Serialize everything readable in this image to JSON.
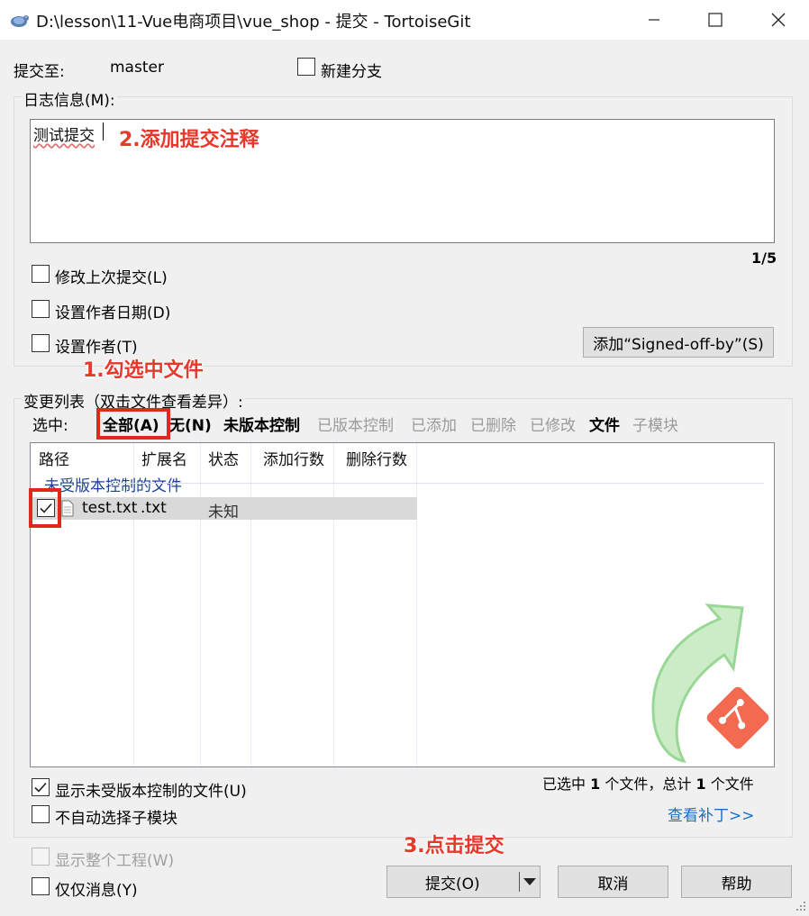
{
  "window": {
    "title": "D:\\lesson\\11-Vue电商项目\\vue_shop - 提交 - TortoiseGit",
    "app_icon": "tortoise-icon"
  },
  "commit_to": {
    "label": "提交至:",
    "branch": "master",
    "new_branch_label": "新建分支",
    "new_branch_checked": false
  },
  "log": {
    "group_label": "日志信息(M):",
    "message": "测试提交",
    "counter": "1/5",
    "amend_label": "修改上次提交(L)",
    "amend_checked": false,
    "set_date_label": "设置作者日期(D)",
    "set_date_checked": false,
    "set_author_label": "设置作者(T)",
    "set_author_checked": false,
    "signed_off_button": "添加“Signed-off-by”(S)"
  },
  "changes": {
    "group_label": "变更列表（双击文件查看差异）:",
    "select_label": "选中:",
    "filters": [
      {
        "label": "全部(A)",
        "style": "bold"
      },
      {
        "label": "无(N)",
        "style": "bold"
      },
      {
        "label": "未版本控制",
        "style": "bold"
      },
      {
        "label": "已版本控制",
        "style": "gray"
      },
      {
        "label": "已添加",
        "style": "gray"
      },
      {
        "label": "已删除",
        "style": "gray"
      },
      {
        "label": "已修改",
        "style": "gray"
      },
      {
        "label": "文件",
        "style": "bold"
      },
      {
        "label": "子模块",
        "style": "gray"
      }
    ],
    "columns": [
      "路径",
      "扩展名",
      "状态",
      "添加行数",
      "删除行数"
    ],
    "group_header": "未受版本控制的文件",
    "rows": [
      {
        "checked": true,
        "path": "test.txt",
        "ext": ".txt",
        "status": "未知",
        "added": "",
        "deleted": "",
        "icon": "text-file-icon"
      }
    ],
    "summary": {
      "pre": "已选中",
      "selected": "1",
      "mid": "个文件，总计",
      "total": "1",
      "post": "个文件"
    },
    "show_unversioned_label": "显示未受版本控制的文件(U)",
    "show_unversioned_checked": true,
    "no_auto_submodule_label": "不自动选择子模块",
    "no_auto_submodule_checked": false,
    "view_patch_link": "查看补丁>>"
  },
  "bottom": {
    "show_whole_project_label": "显示整个工程(W)",
    "show_whole_project_checked": false,
    "show_whole_project_disabled": true,
    "message_only_label": "仅仅消息(Y)",
    "message_only_checked": false,
    "commit_button": "提交(O)",
    "cancel_button": "取消",
    "help_button": "帮助"
  },
  "annotations": {
    "step1": "1.勾选中文件",
    "step2": "2.添加提交注释",
    "step3": "3.点击提交"
  },
  "colors": {
    "annotation_red": "#e8372b",
    "link_blue": "#1a6fc1",
    "group_header_blue": "#1c3f9a",
    "git_logo_red": "#f05133",
    "watermark_green": "#7fd07a"
  }
}
